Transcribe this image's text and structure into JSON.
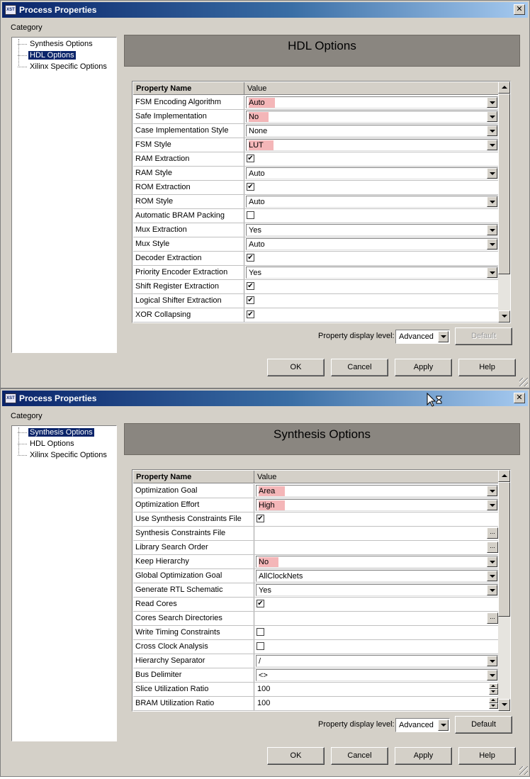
{
  "dialogs": [
    {
      "title": "Process Properties",
      "close_glyph": "✕",
      "category_label": "Category",
      "tree": [
        {
          "label": "Synthesis Options",
          "selected": false
        },
        {
          "label": "HDL Options",
          "selected": true
        },
        {
          "label": "Xilinx Specific Options",
          "selected": false
        }
      ],
      "banner": "HDL Options",
      "columns": {
        "name": "Property Name",
        "value": "Value"
      },
      "rows": [
        {
          "name": "FSM Encoding Algorithm",
          "type": "combo",
          "value": "Auto",
          "highlight": true
        },
        {
          "name": "Safe Implementation",
          "type": "combo",
          "value": "No",
          "highlight": true
        },
        {
          "name": "Case Implementation Style",
          "type": "combo",
          "value": "None",
          "highlight": false
        },
        {
          "name": "FSM Style",
          "type": "combo",
          "value": "LUT",
          "highlight": true
        },
        {
          "name": "RAM Extraction",
          "type": "check",
          "checked": true
        },
        {
          "name": "RAM Style",
          "type": "combo",
          "value": "Auto",
          "highlight": false
        },
        {
          "name": "ROM Extraction",
          "type": "check",
          "checked": true
        },
        {
          "name": "ROM Style",
          "type": "combo",
          "value": "Auto",
          "highlight": false
        },
        {
          "name": "Automatic BRAM Packing",
          "type": "check",
          "checked": false
        },
        {
          "name": "Mux Extraction",
          "type": "combo",
          "value": "Yes",
          "highlight": false
        },
        {
          "name": "Mux Style",
          "type": "combo",
          "value": "Auto",
          "highlight": false
        },
        {
          "name": "Decoder Extraction",
          "type": "check",
          "checked": true
        },
        {
          "name": "Priority Encoder Extraction",
          "type": "combo",
          "value": "Yes",
          "highlight": false
        },
        {
          "name": "Shift Register Extraction",
          "type": "check",
          "checked": true
        },
        {
          "name": "Logical Shifter Extraction",
          "type": "check",
          "checked": true
        },
        {
          "name": "XOR Collapsing",
          "type": "check",
          "checked": true
        }
      ],
      "display_level_label": "Property display level:",
      "display_level_value": "Advanced",
      "buttons": {
        "default": "Default",
        "default_enabled": false,
        "ok": "OK",
        "cancel": "Cancel",
        "apply": "Apply",
        "help": "Help"
      }
    },
    {
      "title": "Process Properties",
      "close_glyph": "✕",
      "category_label": "Category",
      "tree": [
        {
          "label": "Synthesis Options",
          "selected": true
        },
        {
          "label": "HDL Options",
          "selected": false
        },
        {
          "label": "Xilinx Specific Options",
          "selected": false
        }
      ],
      "banner": "Synthesis Options",
      "columns": {
        "name": "Property Name",
        "value": "Value"
      },
      "rows": [
        {
          "name": "Optimization Goal",
          "type": "combo",
          "value": "Area",
          "highlight": true
        },
        {
          "name": "Optimization Effort",
          "type": "combo",
          "value": "High",
          "highlight": true
        },
        {
          "name": "Use Synthesis Constraints File",
          "type": "check",
          "checked": true
        },
        {
          "name": "Synthesis Constraints File",
          "type": "browse",
          "value": ""
        },
        {
          "name": "Library Search Order",
          "type": "browse",
          "value": ""
        },
        {
          "name": "Keep Hierarchy",
          "type": "combo",
          "value": "No",
          "highlight": true
        },
        {
          "name": "Global Optimization Goal",
          "type": "combo",
          "value": "AllClockNets",
          "highlight": false
        },
        {
          "name": "Generate RTL Schematic",
          "type": "combo",
          "value": "Yes",
          "highlight": false
        },
        {
          "name": "Read Cores",
          "type": "check",
          "checked": true
        },
        {
          "name": "Cores Search Directories",
          "type": "browse",
          "value": ""
        },
        {
          "name": "Write Timing Constraints",
          "type": "check",
          "checked": false
        },
        {
          "name": "Cross Clock Analysis",
          "type": "check",
          "checked": false
        },
        {
          "name": "Hierarchy Separator",
          "type": "combo",
          "value": "/",
          "highlight": false
        },
        {
          "name": "Bus Delimiter",
          "type": "combo",
          "value": "<>",
          "highlight": false
        },
        {
          "name": "Slice Utilization Ratio",
          "type": "spin",
          "value": "100"
        },
        {
          "name": "BRAM Utilization Ratio",
          "type": "spin",
          "value": "100"
        }
      ],
      "display_level_label": "Property display level:",
      "display_level_value": "Advanced",
      "buttons": {
        "default": "Default",
        "default_enabled": true,
        "ok": "OK",
        "cancel": "Cancel",
        "apply": "Apply",
        "help": "Help"
      }
    }
  ],
  "icons": {
    "app": "xst-app-icon",
    "close": "close-icon",
    "cursor": "busy-cursor-icon"
  }
}
